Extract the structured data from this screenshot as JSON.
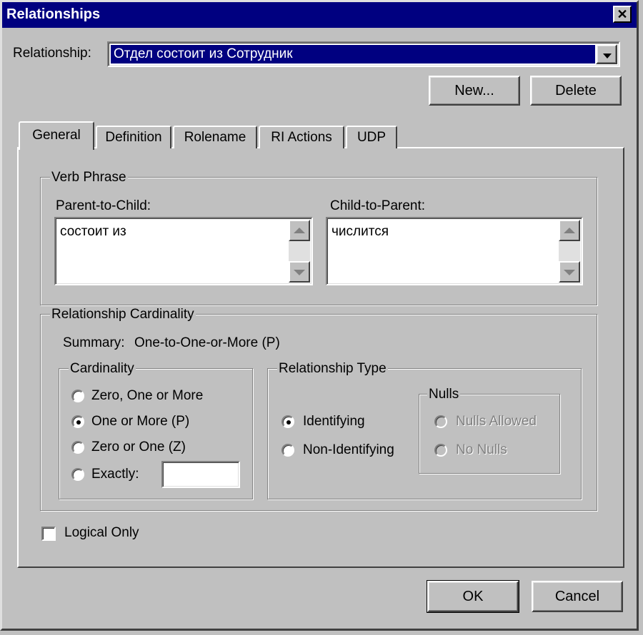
{
  "window": {
    "title": "Relationships",
    "close_glyph": "✕"
  },
  "relationship": {
    "label": "Relationship:",
    "selected": "Отдел состоит из Сотрудник"
  },
  "buttons": {
    "new": "New...",
    "delete": "Delete",
    "ok": "OK",
    "cancel": "Cancel"
  },
  "tabs": [
    {
      "label": "General",
      "active": true
    },
    {
      "label": "Definition",
      "active": false
    },
    {
      "label": "Rolename",
      "active": false
    },
    {
      "label": "RI Actions",
      "active": false
    },
    {
      "label": "UDP",
      "active": false
    }
  ],
  "verb_phrase": {
    "title": "Verb Phrase",
    "parent_to_child_label": "Parent-to-Child:",
    "parent_to_child_value": "состоит из",
    "child_to_parent_label": "Child-to-Parent:",
    "child_to_parent_value": "числится"
  },
  "cardinality_section": {
    "title": "Relationship Cardinality",
    "summary_label": "Summary:",
    "summary_value": "One-to-One-or-More (P)"
  },
  "cardinality": {
    "title": "Cardinality",
    "options": [
      {
        "label": "Zero, One or More",
        "selected": false
      },
      {
        "label": "One or More (P)",
        "selected": true
      },
      {
        "label": "Zero or One (Z)",
        "selected": false
      },
      {
        "label": "Exactly:",
        "selected": false
      }
    ],
    "exactly_value": ""
  },
  "relationship_type": {
    "title": "Relationship Type",
    "options": [
      {
        "label": "Identifying",
        "selected": true
      },
      {
        "label": "Non-Identifying",
        "selected": false
      }
    ]
  },
  "nulls": {
    "title": "Nulls",
    "options": [
      {
        "label": "Nulls Allowed",
        "selected": false,
        "enabled": false
      },
      {
        "label": "No Nulls",
        "selected": false,
        "enabled": false
      }
    ]
  },
  "logical_only": {
    "label": "Logical Only",
    "checked": false
  }
}
